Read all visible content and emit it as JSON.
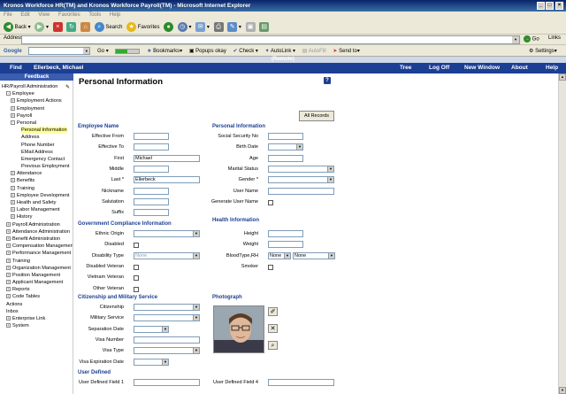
{
  "window": {
    "title": "Kronos Workforce HR(TM) and Kronos Workforce Payroll(TM) - Microsoft Internet Explorer"
  },
  "menubar": [
    "File",
    "Edit",
    "View",
    "Favorites",
    "Tools",
    "Help"
  ],
  "toolbar": {
    "back": "Back",
    "search": "Search",
    "favorites": "Favorites"
  },
  "addressbar": {
    "label": "Address",
    "go": "Go",
    "links": "Links"
  },
  "googlebar": {
    "logo": "Google",
    "go": "Go",
    "bookmarks": "Bookmarks",
    "popups": "Popups okay",
    "check": "Check",
    "autolink": "AutoLink",
    "autofill": "AutoFill",
    "sendto": "Send to",
    "settings": "Settings"
  },
  "app": {
    "remote": "(Remote)",
    "find": "Find",
    "user": "Ellerbeck, Michael",
    "tree": "Tree",
    "logoff": "Log Off",
    "new_window": "New Window",
    "about": "About",
    "help": "Help",
    "feedback": "Feedback"
  },
  "sidebar": {
    "items": [
      {
        "label": "HR/Payroll Administration",
        "indent": 0,
        "pm": "",
        "selected": false
      },
      {
        "label": "Employee",
        "indent": 1,
        "pm": "-",
        "selected": false
      },
      {
        "label": "Employment Actions",
        "indent": 2,
        "pm": "+",
        "selected": false
      },
      {
        "label": "Employment",
        "indent": 2,
        "pm": "+",
        "selected": false
      },
      {
        "label": "Payroll",
        "indent": 2,
        "pm": "+",
        "selected": false
      },
      {
        "label": "Personal",
        "indent": 2,
        "pm": "-",
        "selected": false
      },
      {
        "label": "Personal Information",
        "indent": 3,
        "pm": "",
        "selected": true
      },
      {
        "label": "Address",
        "indent": 3,
        "pm": "",
        "selected": false
      },
      {
        "label": "Phone Number",
        "indent": 3,
        "pm": "",
        "selected": false
      },
      {
        "label": "EMail Address",
        "indent": 3,
        "pm": "",
        "selected": false
      },
      {
        "label": "Emergency Contact",
        "indent": 3,
        "pm": "",
        "selected": false
      },
      {
        "label": "Previous Employment",
        "indent": 3,
        "pm": "",
        "selected": false
      },
      {
        "label": "Attendance",
        "indent": 2,
        "pm": "+",
        "selected": false
      },
      {
        "label": "Benefits",
        "indent": 2,
        "pm": "+",
        "selected": false
      },
      {
        "label": "Training",
        "indent": 2,
        "pm": "+",
        "selected": false
      },
      {
        "label": "Employee Development",
        "indent": 2,
        "pm": "+",
        "selected": false
      },
      {
        "label": "Health and Safety",
        "indent": 2,
        "pm": "+",
        "selected": false
      },
      {
        "label": "Labor Management",
        "indent": 2,
        "pm": "+",
        "selected": false
      },
      {
        "label": "History",
        "indent": 2,
        "pm": "+",
        "selected": false
      },
      {
        "label": "Payroll Administration",
        "indent": 1,
        "pm": "+",
        "selected": false
      },
      {
        "label": "Attendance Administration",
        "indent": 1,
        "pm": "+",
        "selected": false
      },
      {
        "label": "Benefit Administration",
        "indent": 1,
        "pm": "+",
        "selected": false
      },
      {
        "label": "Compensation Management",
        "indent": 1,
        "pm": "+",
        "selected": false
      },
      {
        "label": "Performance Management",
        "indent": 1,
        "pm": "+",
        "selected": false
      },
      {
        "label": "Training",
        "indent": 1,
        "pm": "+",
        "selected": false
      },
      {
        "label": "Organization Management",
        "indent": 1,
        "pm": "+",
        "selected": false
      },
      {
        "label": "Position Management",
        "indent": 1,
        "pm": "+",
        "selected": false
      },
      {
        "label": "Applicant Management",
        "indent": 1,
        "pm": "+",
        "selected": false
      },
      {
        "label": "Reports",
        "indent": 1,
        "pm": "+",
        "selected": false
      },
      {
        "label": "Code Tables",
        "indent": 1,
        "pm": "+",
        "selected": false
      },
      {
        "label": "Actions",
        "indent": 1,
        "pm": "",
        "selected": false
      },
      {
        "label": "Inbox",
        "indent": 1,
        "pm": "",
        "selected": false
      },
      {
        "label": "Enterprise Link",
        "indent": 1,
        "pm": "+",
        "selected": false
      },
      {
        "label": "System",
        "indent": 1,
        "pm": "+",
        "selected": false
      }
    ]
  },
  "page": {
    "title": "Personal Information",
    "all_records": "All Records",
    "help_icon_label": "?",
    "sections": {
      "employee_name": "Employee Name",
      "personal_information": "Personal Information",
      "gov_compliance": "Government Compliance Information",
      "health": "Health Information",
      "citizenship": "Citizenship and Military Service",
      "photograph": "Photograph",
      "user_defined": "User Defined"
    },
    "left_fields": [
      {
        "label": "Effective From",
        "value": "",
        "kind": "input",
        "w": 40
      },
      {
        "label": "Effective To",
        "value": "",
        "kind": "input",
        "w": 40
      },
      {
        "label": "First",
        "value": "Michael",
        "kind": "input",
        "w": 75
      },
      {
        "label": "Middle",
        "value": "",
        "kind": "input",
        "w": 40
      },
      {
        "label": "Last *",
        "value": "Ellerbeck",
        "kind": "input",
        "w": 75
      },
      {
        "label": "Nickname",
        "value": "",
        "kind": "input",
        "w": 40
      },
      {
        "label": "Salutation",
        "value": "",
        "kind": "input",
        "w": 40
      },
      {
        "label": "Suffix",
        "value": "",
        "kind": "input",
        "w": 40
      }
    ],
    "right_fields": [
      {
        "label": "Social Security No",
        "value": "",
        "kind": "input",
        "w": 40
      },
      {
        "label": "Birth Date",
        "value": "",
        "kind": "select",
        "w": 40
      },
      {
        "label": "Age",
        "value": "",
        "kind": "input",
        "w": 40
      },
      {
        "label": "Marital Status",
        "value": "",
        "kind": "select",
        "w": 75
      },
      {
        "label": "Gender *",
        "value": "",
        "kind": "select",
        "w": 75
      },
      {
        "label": "User Name",
        "value": "",
        "kind": "input",
        "w": 75
      },
      {
        "label": "Generate User Name",
        "value": "",
        "kind": "check",
        "w": 6
      }
    ],
    "gov_fields": [
      {
        "label": "Ethnic Origin",
        "value": "",
        "kind": "select",
        "w": 75
      },
      {
        "label": "Disabled",
        "value": "",
        "kind": "check",
        "w": 6
      },
      {
        "label": "Disability Type",
        "value": "None",
        "kind": "select",
        "w": 75
      },
      {
        "label": "Disabled Veteran",
        "value": "",
        "kind": "check",
        "w": 6
      },
      {
        "label": "Vietnam Veteran",
        "value": "",
        "kind": "check",
        "w": 6
      },
      {
        "label": "Other Veteran",
        "value": "",
        "kind": "check",
        "w": 6
      }
    ],
    "health_fields": [
      {
        "label": "Height",
        "value": "",
        "kind": "input",
        "w": 40
      },
      {
        "label": "Weight",
        "value": "",
        "kind": "input",
        "w": 40
      },
      {
        "label": "BloodType,RH",
        "value": "",
        "kind": "blood",
        "w": 75
      },
      {
        "label": "Smoker",
        "value": "",
        "kind": "check",
        "w": 6
      }
    ],
    "blood_type": "None",
    "blood_rh": "None",
    "citizen_fields": [
      {
        "label": "Citizenship",
        "value": "",
        "kind": "select",
        "w": 75
      },
      {
        "label": "Military Service",
        "value": "",
        "kind": "select",
        "w": 75
      },
      {
        "label": "Separation Date",
        "value": "",
        "kind": "select",
        "w": 40
      },
      {
        "label": "Visa Number",
        "value": "",
        "kind": "input",
        "w": 75
      },
      {
        "label": "Visa Type",
        "value": "",
        "kind": "select",
        "w": 75
      },
      {
        "label": "Visa Expiration Date",
        "value": "",
        "kind": "select",
        "w": 40
      }
    ],
    "user_fields": [
      {
        "label": "User Defined Field 1",
        "value": ""
      },
      {
        "label": "User Defined Field 4",
        "value": ""
      }
    ]
  },
  "colors": {
    "nav_bg": "#1c3f94",
    "section_text": "#1c3f94",
    "selected_bg": "#ffff99"
  }
}
